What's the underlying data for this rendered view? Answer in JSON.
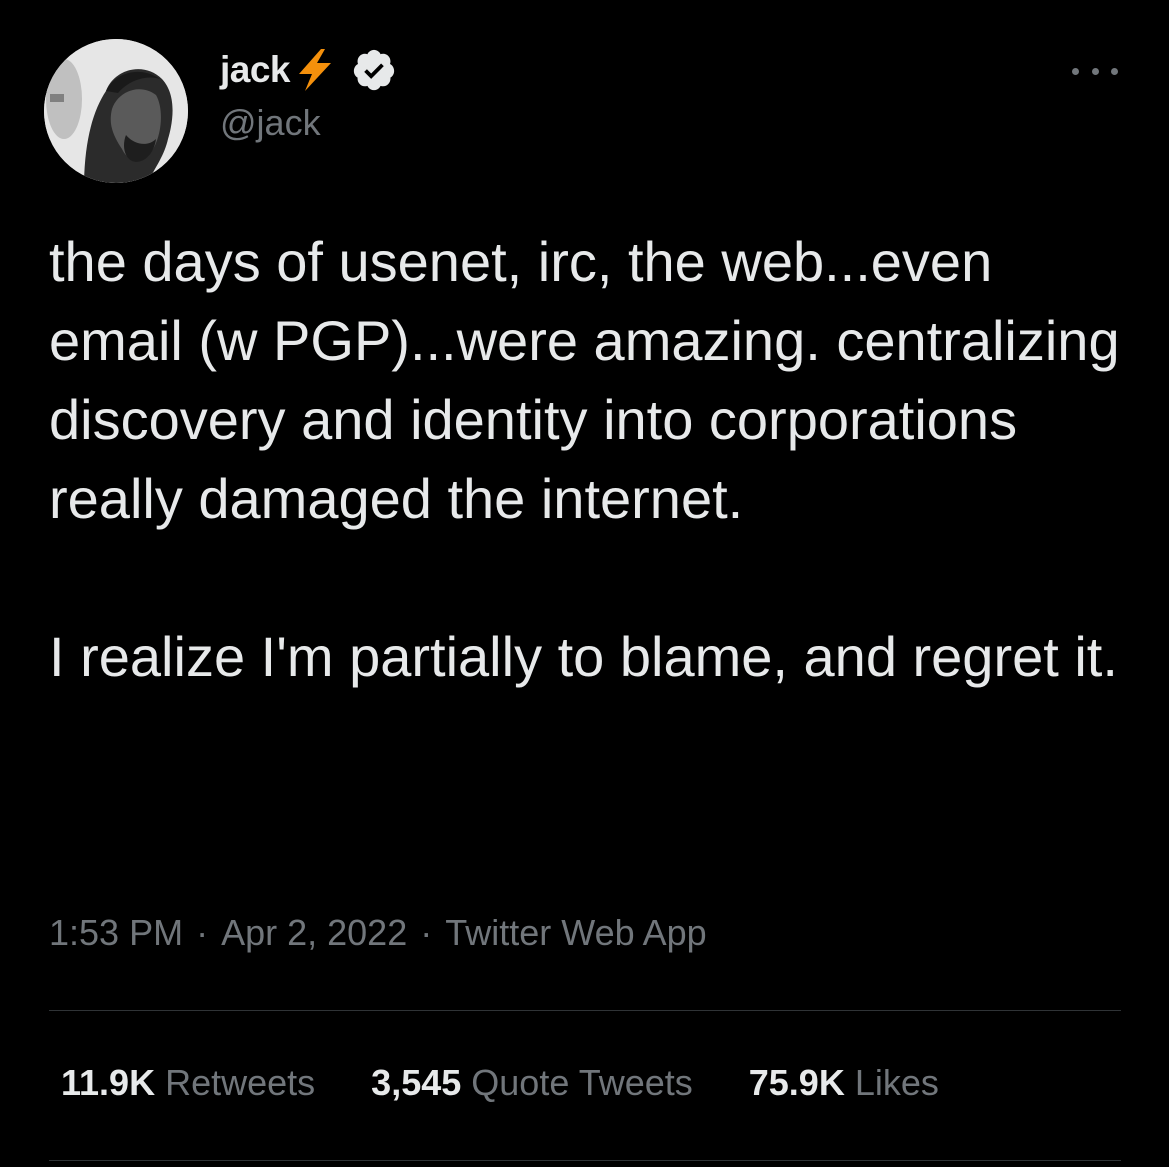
{
  "author": {
    "display_name": "jack",
    "handle": "@jack",
    "verified": true,
    "name_icon": "lightning-bolt-icon",
    "avatar": "avatar-profile-photo"
  },
  "header": {
    "more_icon": "more-options-icon"
  },
  "tweet": {
    "paragraphs": [
      "the days of usenet, irc, the web...even email (w PGP)...were amazing. centralizing discovery and identity into corporations really damaged the internet.",
      "I realize I'm partially to blame, and regret it."
    ]
  },
  "meta": {
    "time": "1:53 PM",
    "separator": "·",
    "date": "Apr 2, 2022",
    "source": "Twitter Web App"
  },
  "stats": {
    "retweets": {
      "count": "11.9K",
      "label": "Retweets"
    },
    "quote_tweets": {
      "count": "3,545",
      "label": "Quote Tweets"
    },
    "likes": {
      "count": "75.9K",
      "label": "Likes"
    }
  },
  "colors": {
    "background": "#000000",
    "primary_text": "#e7e9ea",
    "secondary_text": "#71767b",
    "divider": "#2f3336",
    "bolt": "#f4900c",
    "verified_badge": "#e7e9ea"
  }
}
